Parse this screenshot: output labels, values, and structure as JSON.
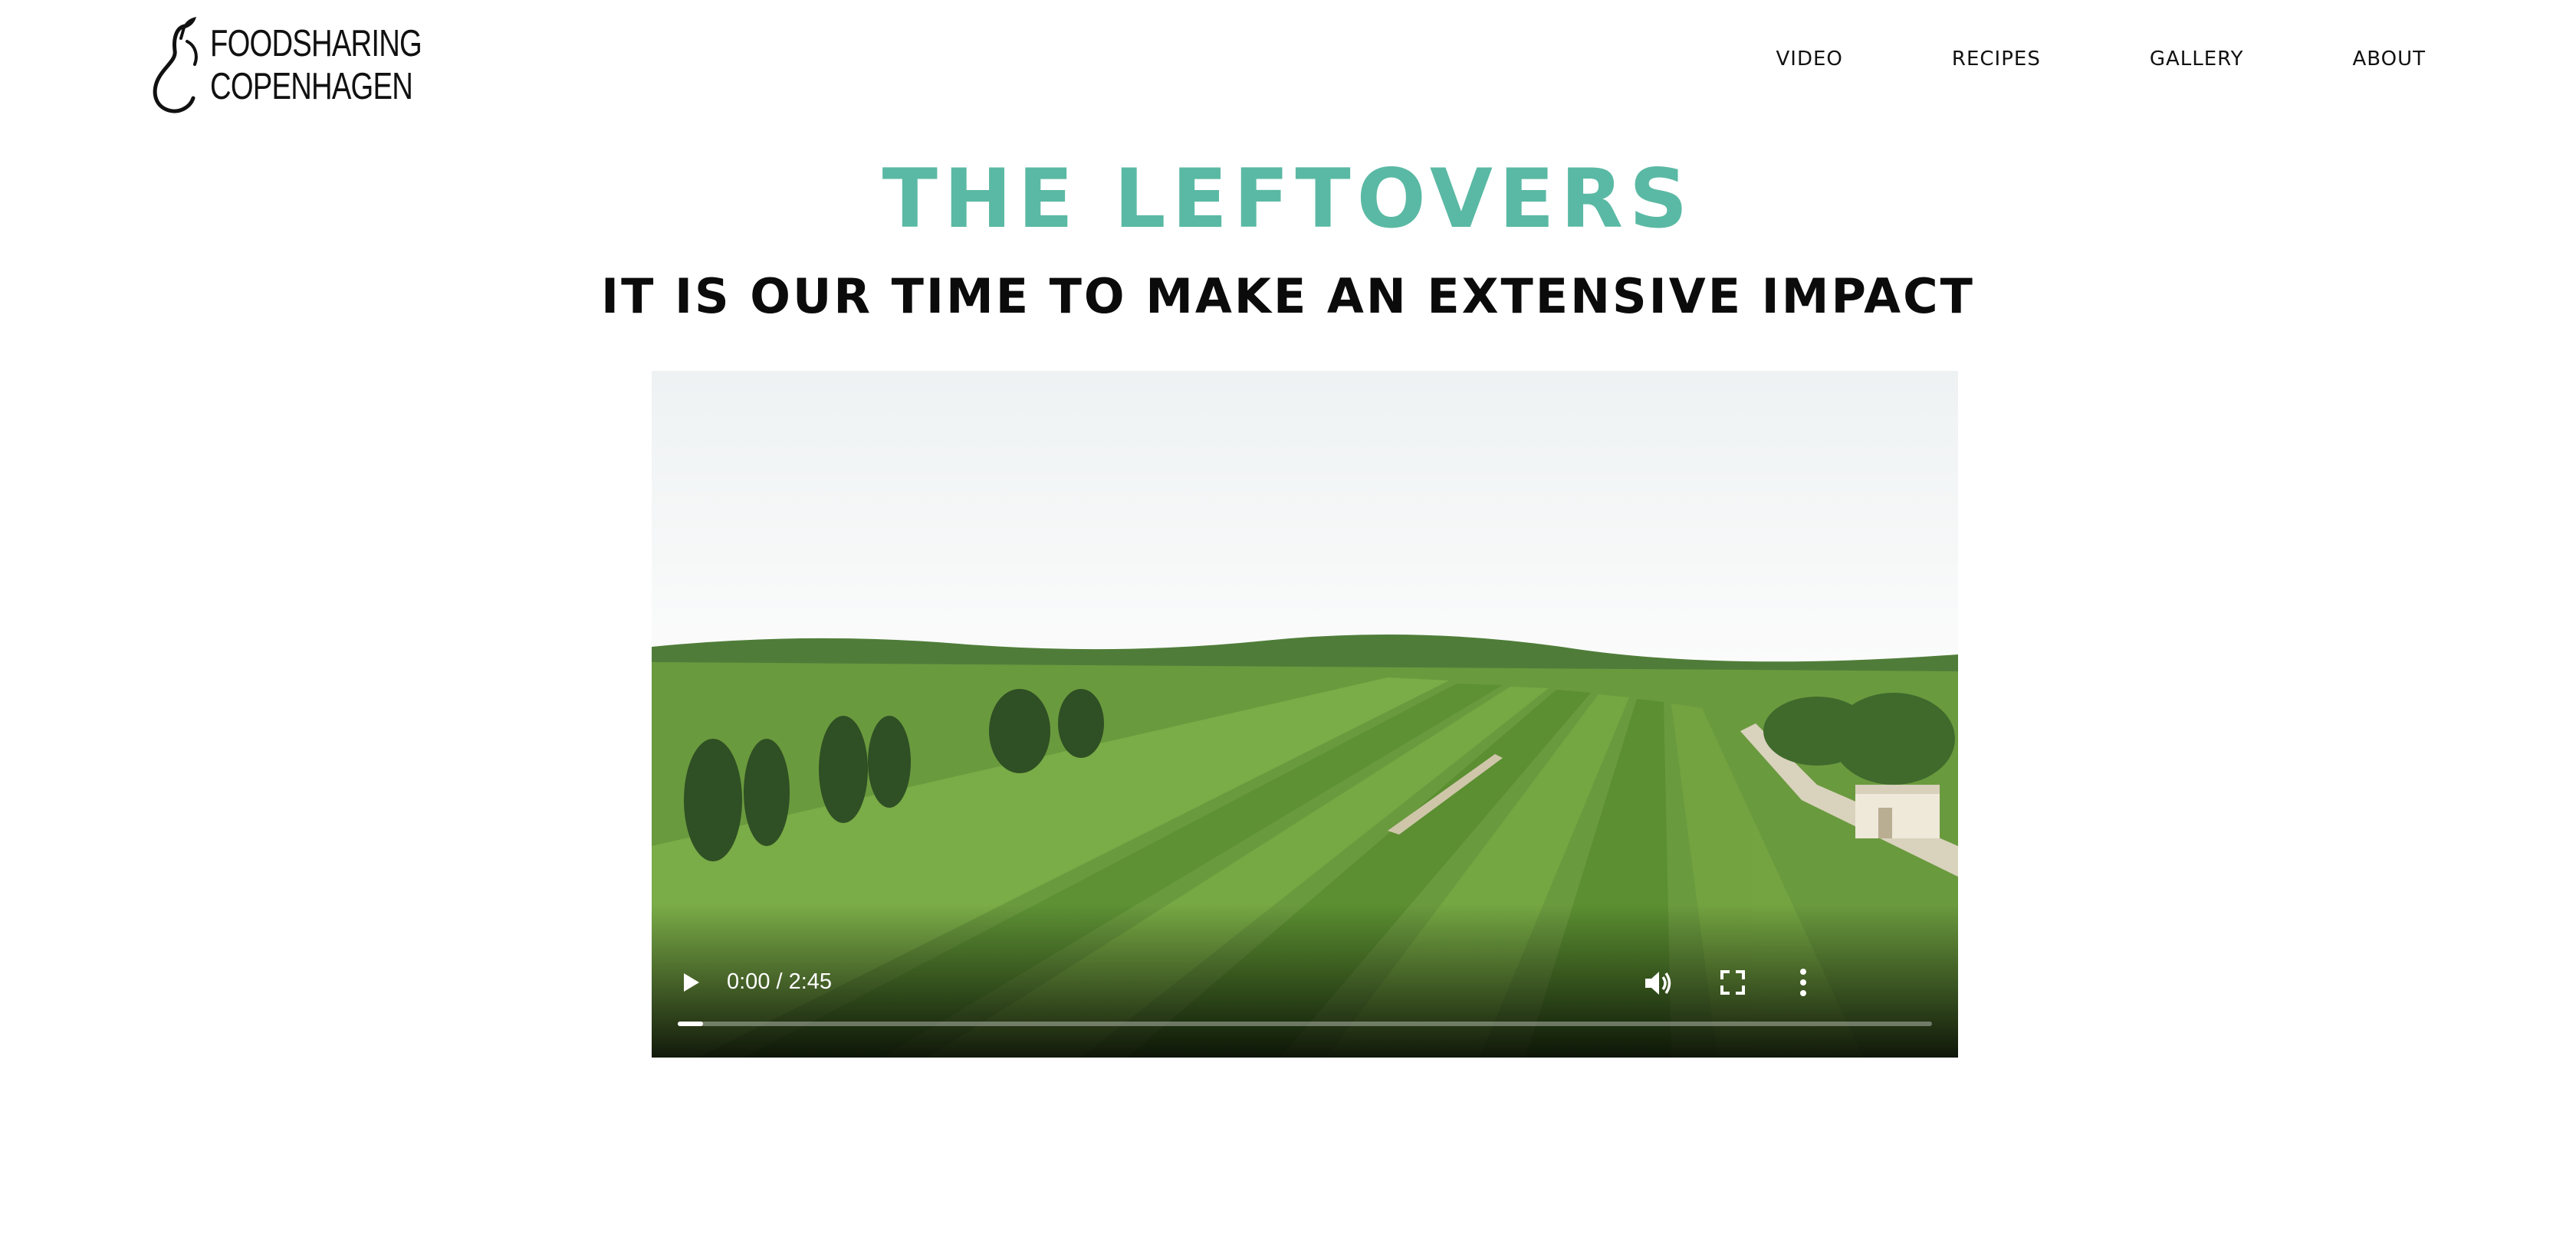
{
  "logo": {
    "line1": "FOODSHARING",
    "line2": "COPENHAGEN",
    "icon": "pear-icon"
  },
  "nav": {
    "items": [
      {
        "label": "VIDEO"
      },
      {
        "label": "RECIPES"
      },
      {
        "label": "GALLERY"
      },
      {
        "label": "ABOUT"
      }
    ]
  },
  "hero": {
    "title": "THE LEFTOVERS",
    "subtitle": "IT IS OUR TIME TO MAKE AN EXTENSIVE IMPACT"
  },
  "video": {
    "time": "0:00 / 2:45",
    "progress": 0.02,
    "icons": [
      "play-icon",
      "volume-icon",
      "fullscreen-icon",
      "more-options-icon"
    ]
  },
  "colors": {
    "title_teal": "#5ab9a4",
    "text_dark": "#111111"
  }
}
